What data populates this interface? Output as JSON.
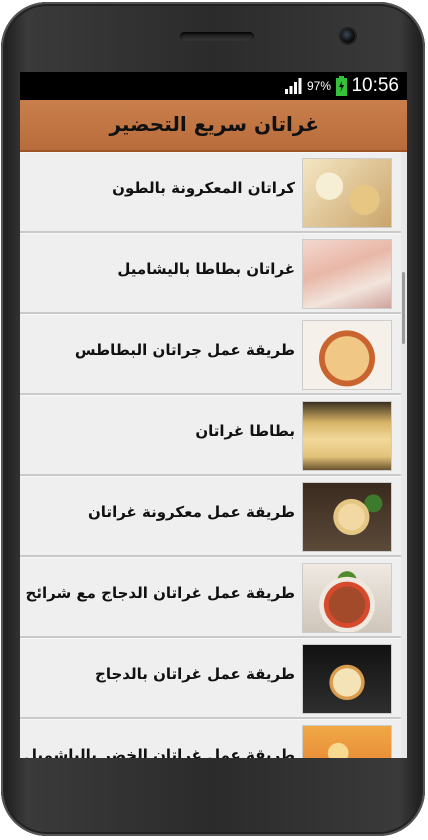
{
  "status_bar": {
    "time": "10:56",
    "battery_percent": "97%",
    "signal_icon": "signal-bars-icon",
    "battery_icon": "battery-charging-icon",
    "accent_color": "#35c23b"
  },
  "app_bar": {
    "title": "غراتان سريع التحضير",
    "background_color": "#b8703d"
  },
  "recipes": [
    {
      "label": "كراتان المعكرونة بالطون"
    },
    {
      "label": "غراتان بطاطا باليشاميل"
    },
    {
      "label": "طريقة عمل جراتان البطاطس"
    },
    {
      "label": "بطاطا غراتان"
    },
    {
      "label": "طريقة عمل معكرونة غراتان"
    },
    {
      "label": "طريقة عمل غراتان الدجاج مع شرائح الباذنجان"
    },
    {
      "label": "طريقة عمل غراتان بالدجاج"
    },
    {
      "label": "طريقة عمل غراتان الخضر بالباشميل"
    }
  ]
}
